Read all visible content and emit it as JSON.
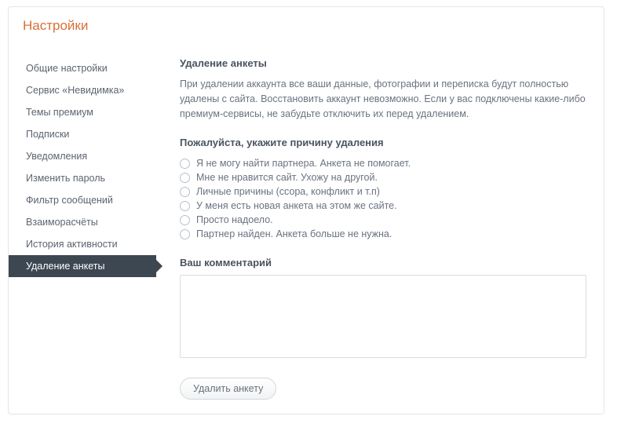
{
  "header": {
    "title": "Настройки"
  },
  "sidebar": {
    "items": [
      {
        "label": "Общие настройки",
        "active": false
      },
      {
        "label": "Сервис «Невидимка»",
        "active": false
      },
      {
        "label": "Темы премиум",
        "active": false
      },
      {
        "label": "Подписки",
        "active": false
      },
      {
        "label": "Уведомления",
        "active": false
      },
      {
        "label": "Изменить пароль",
        "active": false
      },
      {
        "label": "Фильтр сообщений",
        "active": false
      },
      {
        "label": "Взаиморасчёты",
        "active": false
      },
      {
        "label": "История активности",
        "active": false
      },
      {
        "label": "Удаление анкеты",
        "active": true
      }
    ]
  },
  "main": {
    "heading": "Удаление анкеты",
    "description": "При удалении аккаунта все ваши данные, фотографии и переписка будут полностью удалены с сайта. Восстановить аккаунт невозможно. Если у вас подключены какие-либо премиум-сервисы, не забудьте отключить их перед удалением.",
    "reason_heading": "Пожалуйста, укажите причину удаления",
    "reasons": [
      "Я не могу найти партнера. Анкета не помогает.",
      "Мне не нравится сайт. Ухожу на другой.",
      "Личные причины (ссора, конфликт и т.п)",
      "У меня есть новая анкета на этом же сайте.",
      "Просто надоело.",
      "Партнер найден. Анкета больше не нужна."
    ],
    "comment_label": "Ваш комментарий",
    "comment_value": "",
    "delete_button": "Удалить анкету"
  }
}
